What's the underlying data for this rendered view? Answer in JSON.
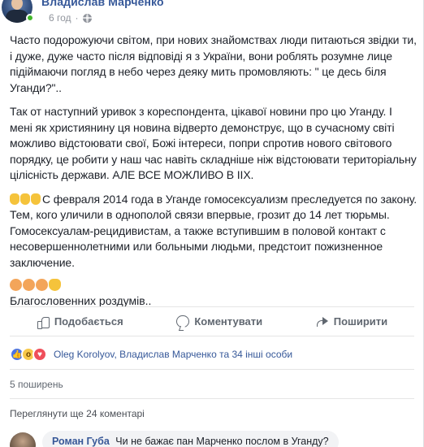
{
  "post": {
    "author": "Владислав Марченко",
    "time": "6 год",
    "privacy_icon": "globe-icon",
    "paragraphs": [
      "Часто подорожуючи світом, при нових знайомствах люди питаються звідки ти, і дуже, дуже часто після відповіді я з України, вони роблять розумне лице підіймаючи погляд в небо через деяку мить промовляють: \" це десь біля Уганди?\"..",
      "Так от наступний уривок з кореспондента, цікавої новини про цю Уганду. І мені як християнину ця новина відверто демонструє, що в сучасному світі можливо відстоювати свої, Божі інтереси, попри спротив нового світового порядку, це робити у наш час навіть складніше ніж відстоювати територіальну цілісність держави. АЛЕ ВСЕ МОЖЛИВО В ІІХ.",
      "С февраля 2014 года в Уганде гомосексуализм преследуется по закону. Тем, кого уличили в однополой связи впервые, грозит до 14 лет тюрьмы. Гомосексуалам-рецидивистам, а также вступившим в половой контакт с несовершеннолетними или больными людьми, предстоит пожизненное заключение."
    ],
    "closing": "Благословенних роздумів.."
  },
  "actions": {
    "like": "Подобається",
    "comment": "Коментувати",
    "share": "Поширити"
  },
  "reactions": {
    "names": "Oleg Korolyov, Владислав Марченко та 34 інші особи"
  },
  "shares": "5 поширень",
  "more_comments": "Переглянути ще 24 коментарі",
  "comment": {
    "author": "Роман Губа",
    "text": "Чи не бажає пан Марченко послом в Уганду?"
  },
  "colors": {
    "link": "#365899",
    "muted": "#90949c",
    "online": "#42b72a",
    "like_reaction": "#4b74e6",
    "wow_reaction": "#f7c84a",
    "love_reaction": "#ef4f5b"
  }
}
